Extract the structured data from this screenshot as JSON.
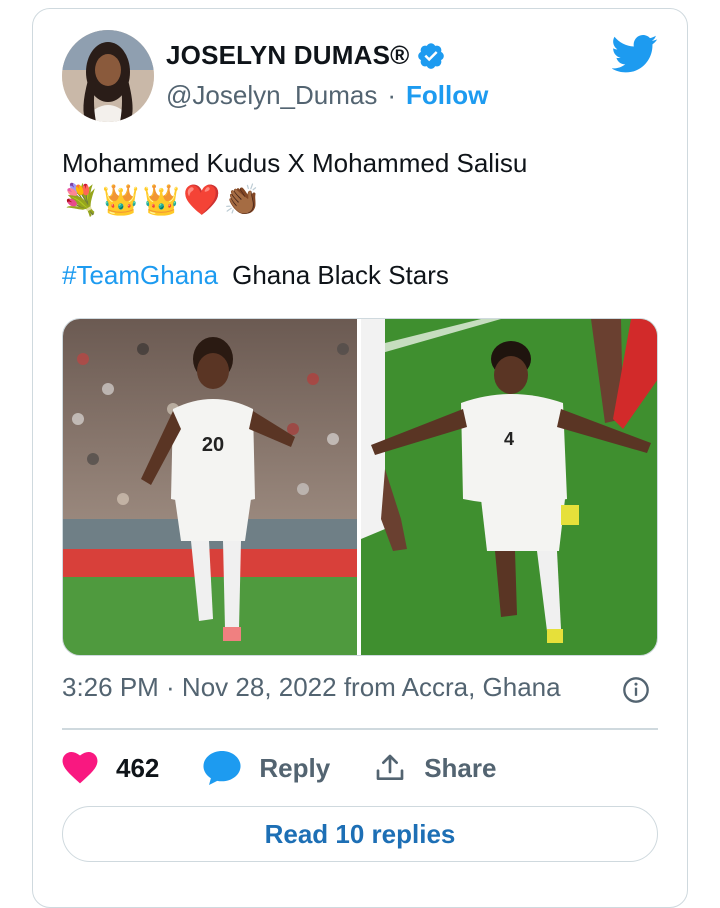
{
  "author": {
    "display_name": "JOSELYN DUMAS®",
    "handle": "@Joselyn_Dumas",
    "separator": "·",
    "follow_label": "Follow"
  },
  "tweet": {
    "text_line": "Mohammed Kudus X Mohammed Salisu",
    "emojis": [
      "💐",
      "👑",
      "👑",
      "❤️",
      "👏🏾"
    ],
    "hashtag": "#TeamGhana",
    "tag_text": "Ghana Black Stars"
  },
  "media": {
    "left_jersey_number": "20",
    "right_jersey_number": "4"
  },
  "meta": {
    "timestamp": "3:26 PM · Nov 28, 2022 from Accra, Ghana"
  },
  "actions": {
    "likes": "462",
    "reply_label": "Reply",
    "share_label": "Share",
    "read_replies_label": "Read 10 replies"
  },
  "colors": {
    "accent": "#1d9bf0",
    "heart": "#f91880",
    "text": "#0f1419",
    "muted": "#536471",
    "border": "#cfd9de"
  },
  "icons": [
    "verified-badge-icon",
    "twitter-bird-icon",
    "info-icon",
    "heart-icon",
    "reply-bubble-icon",
    "share-icon"
  ]
}
